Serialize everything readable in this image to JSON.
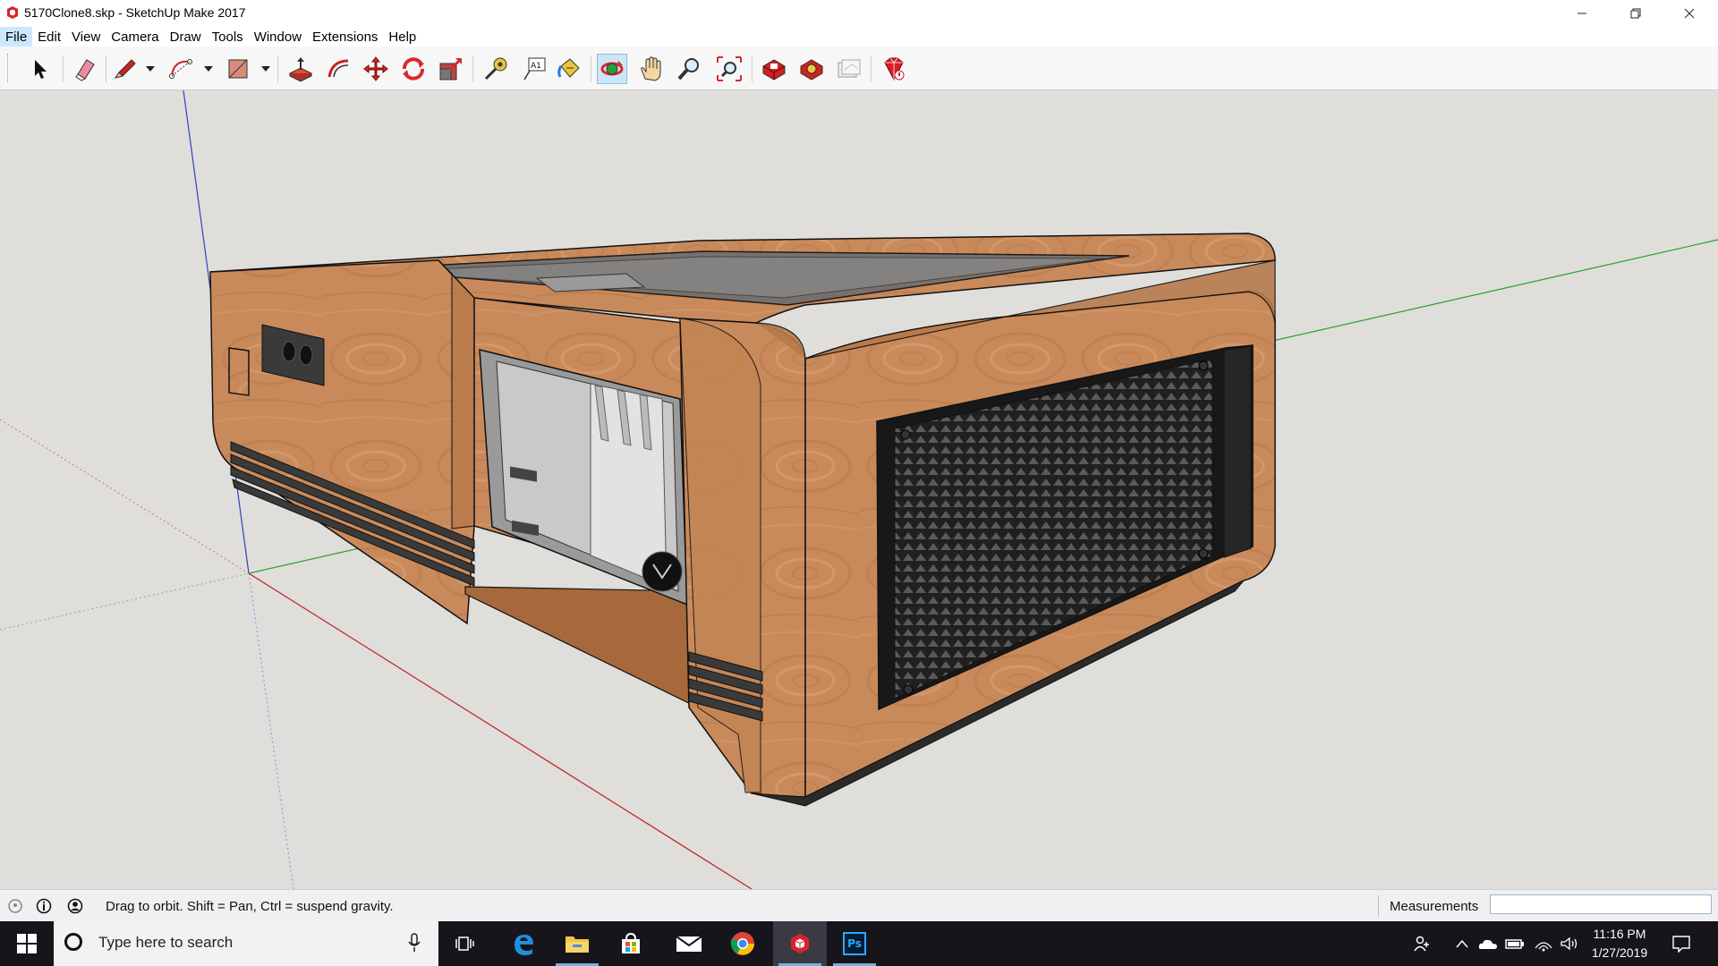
{
  "window": {
    "title": "5170Clone8.skp - SketchUp Make 2017",
    "app_icon": "sketchup-icon",
    "controls": [
      "minimize-icon",
      "restore-icon",
      "close-icon"
    ]
  },
  "menubar": {
    "items": [
      "File",
      "Edit",
      "View",
      "Camera",
      "Draw",
      "Tools",
      "Window",
      "Extensions",
      "Help"
    ],
    "active_index": 0
  },
  "toolbar": {
    "tools": [
      {
        "name": "select",
        "icon": "arrow-cursor-icon"
      },
      {
        "name": "eraser",
        "icon": "eraser-icon"
      },
      {
        "name": "line",
        "icon": "pencil-icon"
      },
      {
        "name": "arc",
        "icon": "arc-icon"
      },
      {
        "name": "shape",
        "icon": "rectangle-icon"
      },
      {
        "name": "push-pull",
        "icon": "push-pull-icon"
      },
      {
        "name": "offset",
        "icon": "offset-icon"
      },
      {
        "name": "move",
        "icon": "move-icon"
      },
      {
        "name": "rotate",
        "icon": "rotate-icon"
      },
      {
        "name": "scale",
        "icon": "scale-icon"
      },
      {
        "name": "tape-measure",
        "icon": "tape-measure-icon"
      },
      {
        "name": "text",
        "icon": "text-icon",
        "label": "A1"
      },
      {
        "name": "paint-bucket",
        "icon": "paint-bucket-icon"
      },
      {
        "name": "orbit",
        "icon": "orbit-icon",
        "selected": true
      },
      {
        "name": "pan",
        "icon": "hand-icon"
      },
      {
        "name": "zoom",
        "icon": "magnifier-icon"
      },
      {
        "name": "zoom-extents",
        "icon": "zoom-extents-icon"
      },
      {
        "name": "3d-warehouse",
        "icon": "warehouse-icon"
      },
      {
        "name": "extension-warehouse",
        "icon": "extension-icon"
      },
      {
        "name": "layout",
        "icon": "layout-icon"
      },
      {
        "name": "extension-manager",
        "icon": "ruby-gem-icon"
      }
    ]
  },
  "status": {
    "message": "Drag to orbit. Shift = Pan, Ctrl = suspend gravity.",
    "measurements_label": "Measurements",
    "measurements_value": ""
  },
  "taskbar": {
    "search_placeholder": "Type here to search",
    "apps": [
      "task-view-icon",
      "edge-icon",
      "file-explorer-icon",
      "store-icon",
      "mail-icon",
      "chrome-icon",
      "sketchup-icon",
      "photoshop-icon"
    ],
    "photoshop_label": "Ps",
    "time": "11:16 PM",
    "date": "1/27/2019"
  },
  "colors": {
    "wood": "#c98a5b",
    "viewport_bg": "#dfdedb",
    "selected_tool": "#cde6f7",
    "taskbar": "#15151b"
  }
}
